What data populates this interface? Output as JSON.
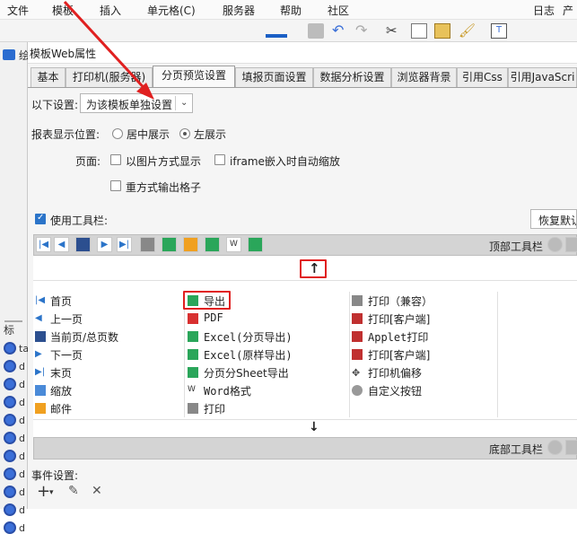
{
  "menubar": {
    "items": [
      "文件",
      "模板",
      "插入",
      "单元格(C)",
      "服务器",
      "帮助",
      "社区"
    ],
    "right": [
      "日志",
      "产"
    ]
  },
  "dialog": {
    "title": "模板Web属性",
    "tabs": [
      "基本",
      "打印机(服务器)",
      "分页预览设置",
      "填报页面设置",
      "数据分析设置",
      "浏览器背景",
      "引用Css",
      "引用JavaScri"
    ],
    "active_tab": 2,
    "setting_label": "以下设置:",
    "setting_value": "为该模板单独设置",
    "position_label": "报表显示位置:",
    "position_center": "居中展示",
    "position_left": "左展示",
    "page_label": "页面:",
    "page_opt1": "以图片方式显示",
    "page_opt2": "iframe嵌入时自动缩放",
    "page_opt3": "重方式输出格子",
    "use_toolbar": "使用工具栏:",
    "restore_btn": "恢复默认",
    "top_toolbar_label": "顶部工具栏",
    "bottom_toolbar_label": "底部工具栏",
    "event_label": "事件设置:",
    "up_arrow": "↑",
    "down_arrow": "↓"
  },
  "buttons": {
    "col1": [
      "首页",
      "上一页",
      "当前页/总页数",
      "下一页",
      "末页",
      "缩放",
      "邮件"
    ],
    "col2": [
      "导出",
      "PDF",
      "Excel(分页导出)",
      "Excel(原样导出)",
      "分页分Sheet导出",
      "Word格式",
      "打印"
    ],
    "col3": [
      "打印（兼容）",
      "打印[客户端]",
      "Applet打印",
      "打印[客户端]",
      "打印机偏移",
      "自定义按钮",
      ""
    ]
  },
  "sidebar": {
    "top_letters": [
      "绘"
    ],
    "rows": [
      "ta",
      "d",
      "d",
      "d",
      "d",
      "d",
      "d",
      "d",
      "d",
      "d",
      "d",
      "d"
    ],
    "bullets": [
      "标",
      "标"
    ]
  },
  "colors": {
    "accent": "#2b74c9",
    "highlight": "#e02020",
    "toolbar_band": "#d4d4d4"
  }
}
